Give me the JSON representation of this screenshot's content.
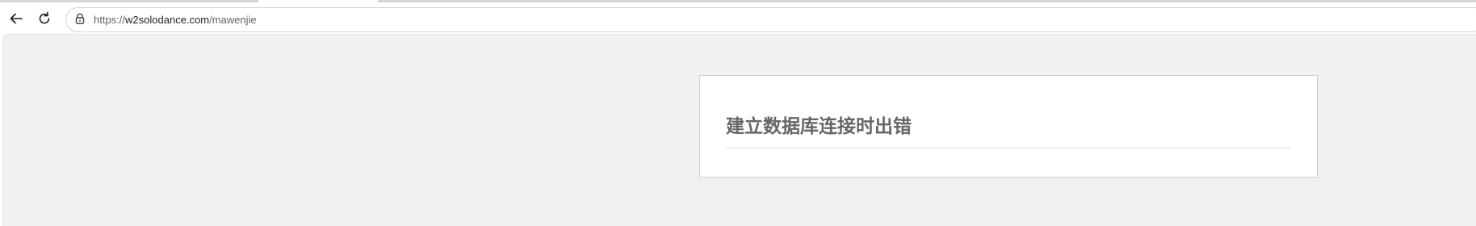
{
  "browser": {
    "url_scheme": "https://",
    "url_host": "w2solodance.com",
    "url_path": "/mawenjie",
    "icons": {
      "back": "arrow-left-icon",
      "reload": "reload-icon",
      "site_info": "tune-lock-icon"
    }
  },
  "page": {
    "error_title": "建立数据库连接时出错"
  },
  "colors": {
    "viewport_bg": "#f1f1f1",
    "box_border": "#cccccc",
    "title_text": "#666666"
  }
}
